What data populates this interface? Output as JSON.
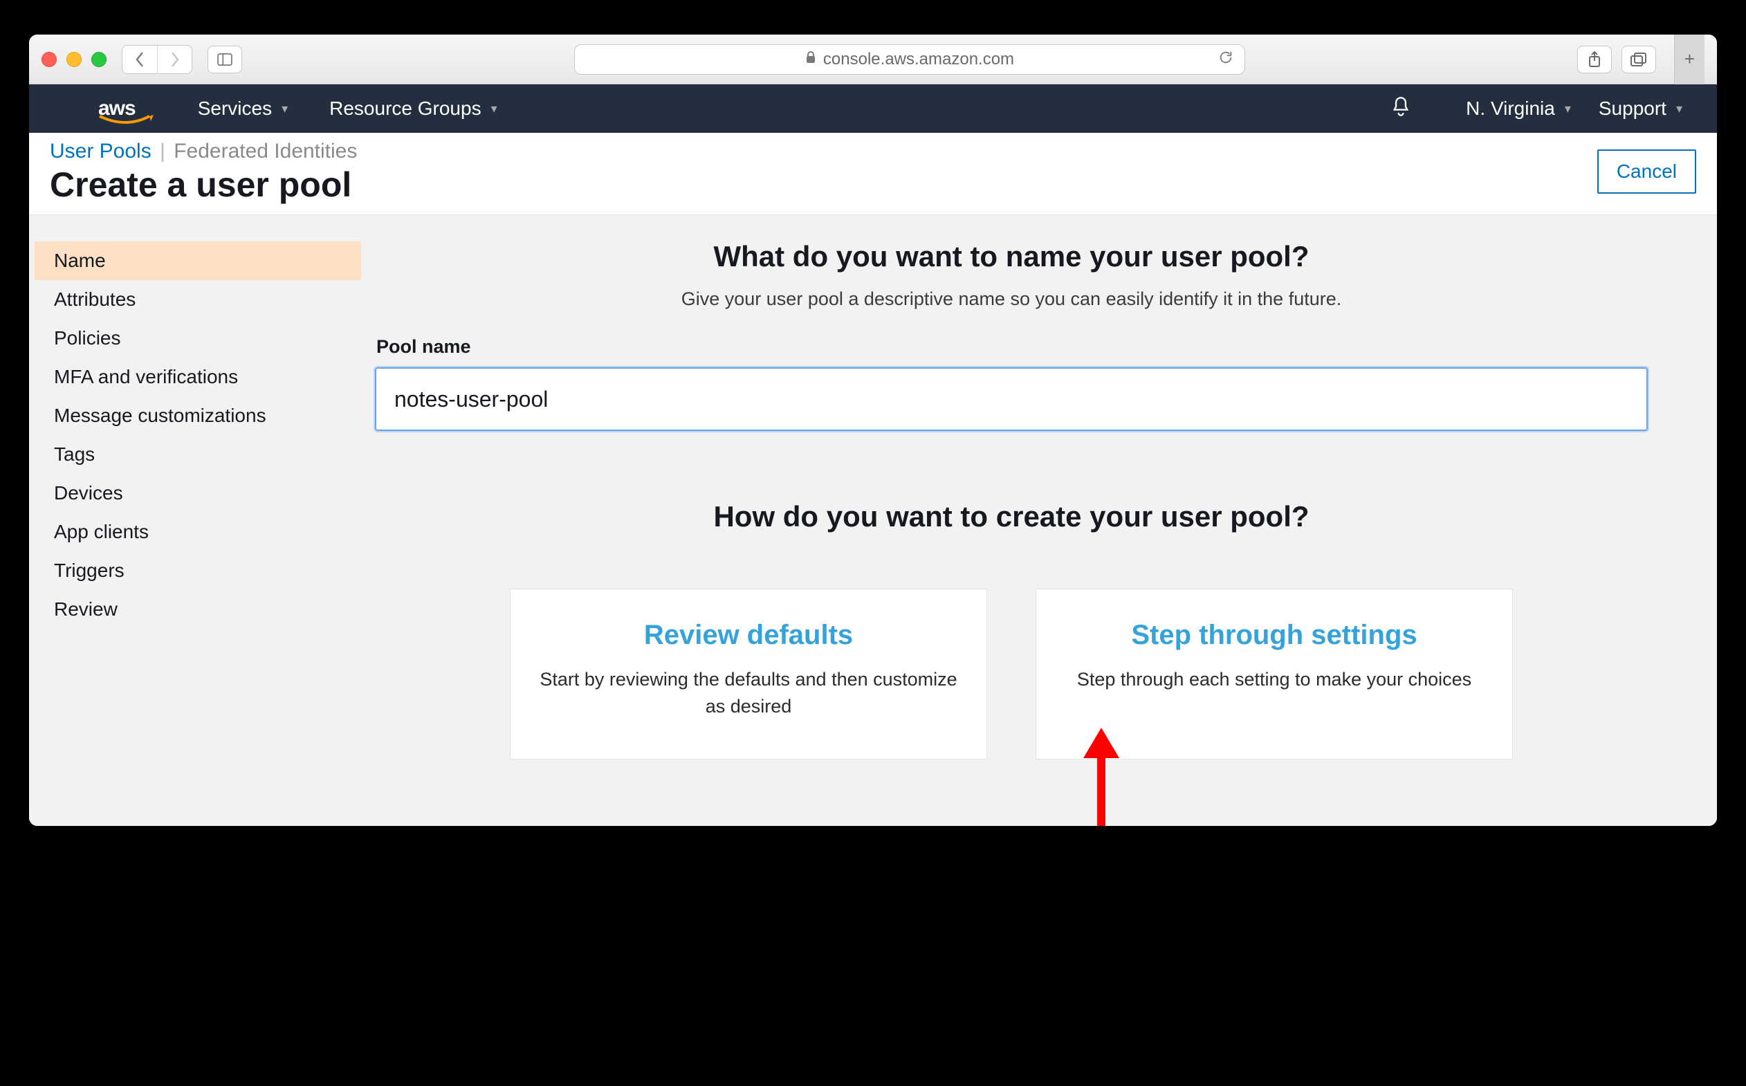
{
  "browser": {
    "url_host": "console.aws.amazon.com"
  },
  "nav": {
    "logo": "aws",
    "services": "Services",
    "resource_groups": "Resource Groups",
    "region": "N. Virginia",
    "support": "Support"
  },
  "header": {
    "crumb1": "User Pools",
    "crumb2": "Federated Identities",
    "title": "Create a user pool",
    "cancel": "Cancel"
  },
  "steps": [
    "Name",
    "Attributes",
    "Policies",
    "MFA and verifications",
    "Message customizations",
    "Tags",
    "Devices",
    "App clients",
    "Triggers",
    "Review"
  ],
  "main": {
    "q1": "What do you want to name your user pool?",
    "q1_sub": "Give your user pool a descriptive name so you can easily identify it in the future.",
    "pool_label": "Pool name",
    "pool_value": "notes-user-pool",
    "q2": "How do you want to create your user pool?",
    "cards": [
      {
        "title": "Review defaults",
        "desc": "Start by reviewing the defaults and then customize as desired"
      },
      {
        "title": "Step through settings",
        "desc": "Step through each setting to make your choices"
      }
    ]
  }
}
